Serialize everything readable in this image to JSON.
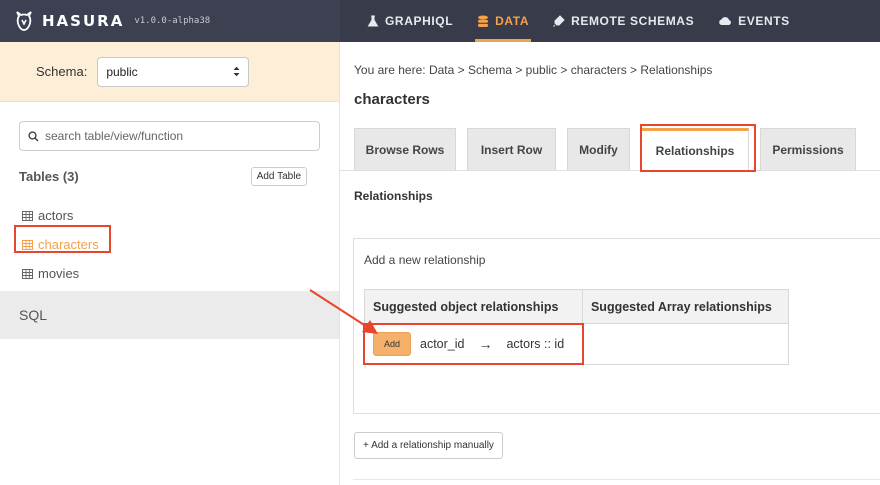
{
  "app": {
    "brand": "HASURA",
    "version": "v1.0.0-alpha38"
  },
  "nav": {
    "items": [
      {
        "label": "GRAPHIQL",
        "icon": "flask-icon",
        "active": false
      },
      {
        "label": "DATA",
        "icon": "database-icon",
        "active": true
      },
      {
        "label": "REMOTE SCHEMAS",
        "icon": "plug-icon",
        "active": false
      },
      {
        "label": "EVENTS",
        "icon": "cloud-icon",
        "active": false
      }
    ]
  },
  "sidebar": {
    "schema_label": "Schema:",
    "schema_value": "public",
    "search_placeholder": "search table/view/function",
    "tables_title": "Tables (3)",
    "add_table_label": "Add Table",
    "tables": [
      {
        "name": "actors",
        "active": false
      },
      {
        "name": "characters",
        "active": true
      },
      {
        "name": "movies",
        "active": false
      }
    ],
    "sql_label": "SQL"
  },
  "main": {
    "breadcrumb": "You are here: Data > Schema > public > characters > Relationships",
    "title": "characters",
    "tabs": [
      {
        "label": "Browse Rows",
        "active": false
      },
      {
        "label": "Insert Row",
        "active": false
      },
      {
        "label": "Modify",
        "active": false
      },
      {
        "label": "Relationships",
        "active": true
      },
      {
        "label": "Permissions",
        "active": false
      }
    ],
    "section_title": "Relationships",
    "panel_title": "Add a new relationship",
    "suggested": {
      "object_header": "Suggested object relationships",
      "array_header": "Suggested Array relationships",
      "add_label": "Add",
      "from_column": "actor_id",
      "arrow": "→",
      "to_column": "actors :: id"
    },
    "manual_button": "+ Add a relationship manually"
  },
  "colors": {
    "accent": "#f3a14a",
    "highlight": "#e8452f",
    "nav_bg": "#373b4a",
    "schema_bg": "#fdeed8"
  }
}
